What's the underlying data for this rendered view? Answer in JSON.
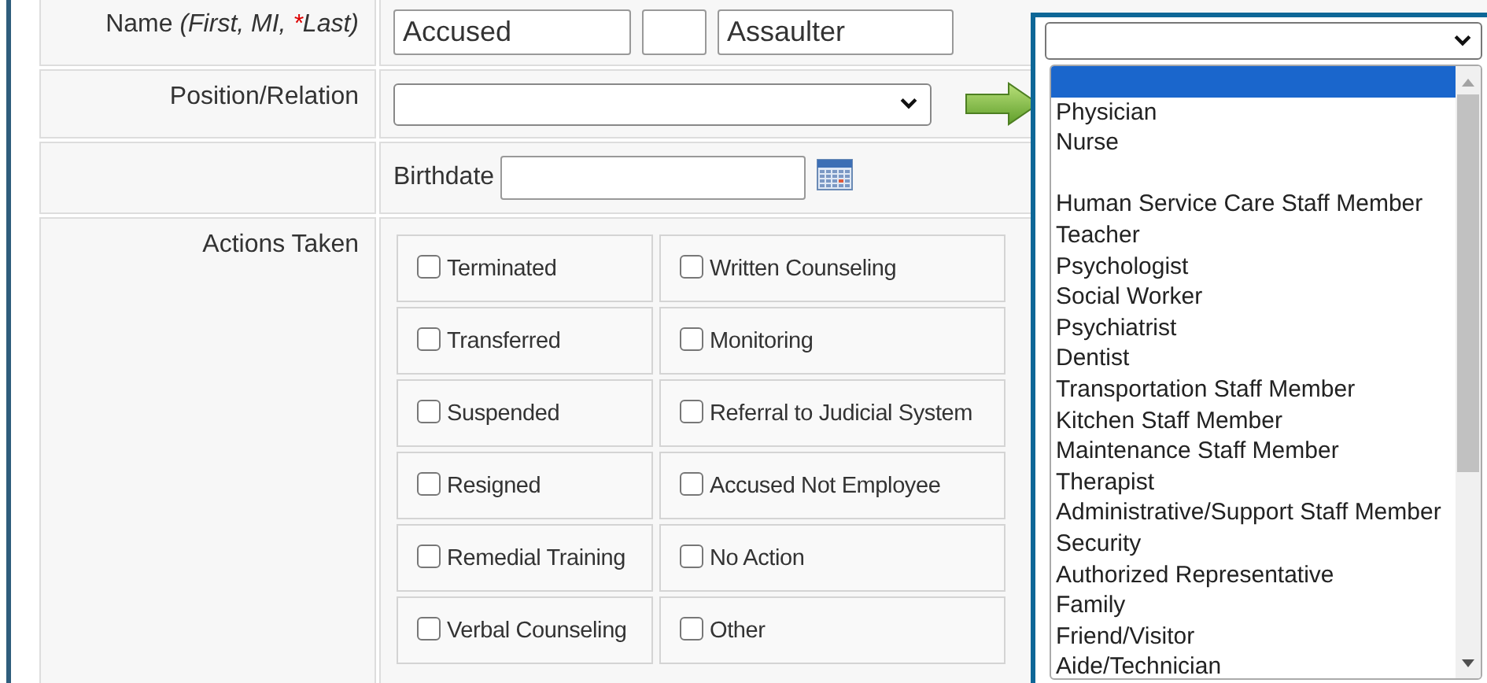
{
  "name_row": {
    "label": "Name",
    "note_start": "(First, MI, ",
    "required_mark": "*",
    "note_end": "Last)",
    "first": "Accused",
    "last": "Assaulter"
  },
  "position_row": {
    "label": "Position/Relation"
  },
  "birthdate_row": {
    "label": "Birthdate"
  },
  "actions": {
    "label": "Actions Taken",
    "items": [
      {
        "label": "Terminated",
        "checked": false
      },
      {
        "label": "Written Counseling",
        "checked": false
      },
      {
        "label": "Transferred",
        "checked": false
      },
      {
        "label": "Monitoring",
        "checked": false
      },
      {
        "label": "Suspended",
        "checked": false
      },
      {
        "label": "Referral to Judicial System",
        "checked": false
      },
      {
        "label": "Resigned",
        "checked": false
      },
      {
        "label": "Accused Not Employee",
        "checked": false
      },
      {
        "label": "Remedial Training",
        "checked": false
      },
      {
        "label": "No Action",
        "checked": false
      },
      {
        "label": "Verbal Counseling",
        "checked": false
      },
      {
        "label": "Other",
        "checked": false
      }
    ]
  },
  "dropdown": {
    "options": [
      {
        "kind": "blank",
        "selected": true
      },
      {
        "kind": "option",
        "label": "Physician",
        "selected": false
      },
      {
        "kind": "option",
        "label": "Nurse",
        "selected": false
      },
      {
        "kind": "separator"
      },
      {
        "kind": "option",
        "label": "Human Service Care Staff Member",
        "selected": false
      },
      {
        "kind": "option",
        "label": "Teacher",
        "selected": false
      },
      {
        "kind": "option",
        "label": "Psychologist",
        "selected": false
      },
      {
        "kind": "option",
        "label": "Social Worker",
        "selected": false
      },
      {
        "kind": "option",
        "label": "Psychiatrist",
        "selected": false
      },
      {
        "kind": "option",
        "label": "Dentist",
        "selected": false
      },
      {
        "kind": "option",
        "label": "Transportation Staff Member",
        "selected": false
      },
      {
        "kind": "option",
        "label": "Kitchen Staff Member",
        "selected": false
      },
      {
        "kind": "option",
        "label": "Maintenance Staff Member",
        "selected": false
      },
      {
        "kind": "option",
        "label": "Therapist",
        "selected": false
      },
      {
        "kind": "option",
        "label": "Administrative/Support Staff Member",
        "selected": false
      },
      {
        "kind": "option",
        "label": "Security",
        "selected": false
      },
      {
        "kind": "option",
        "label": "Authorized Representative",
        "selected": false
      },
      {
        "kind": "option",
        "label": "Family",
        "selected": false
      },
      {
        "kind": "option",
        "label": "Friend/Visitor",
        "selected": false
      },
      {
        "kind": "option",
        "label": "Aide/Technician",
        "selected": false
      }
    ]
  }
}
